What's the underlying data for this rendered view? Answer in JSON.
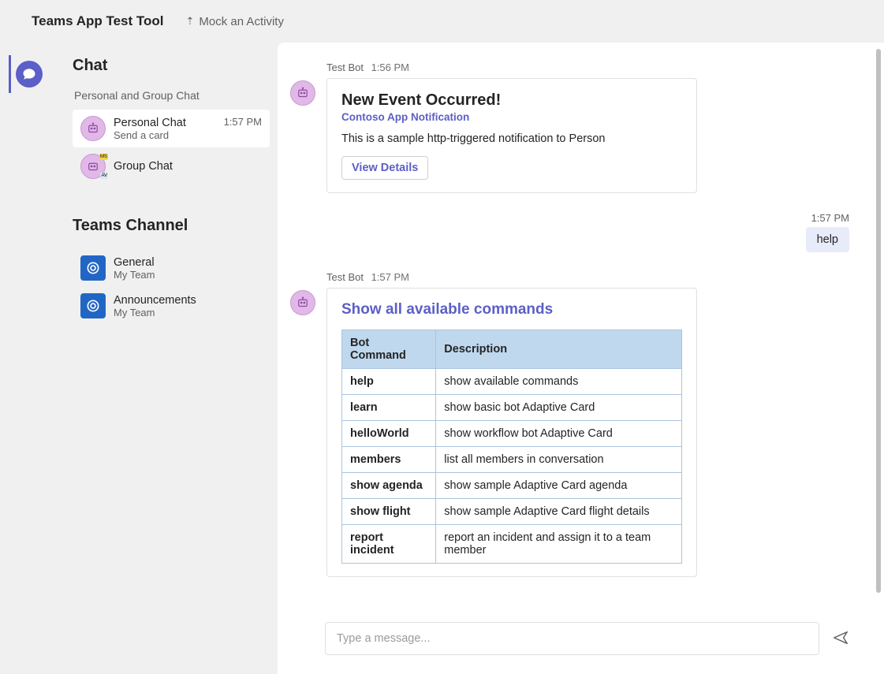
{
  "topbar": {
    "title": "Teams App Test Tool",
    "mock_label": "Mock an Activity"
  },
  "rail": {
    "active": "chat"
  },
  "sidebar": {
    "chat_header": "Chat",
    "chat_subheader": "Personal and Group Chat",
    "items": [
      {
        "title": "Personal Chat",
        "subtitle": "Send a card",
        "time": "1:57 PM",
        "selected": true
      },
      {
        "title": "Group Chat",
        "subtitle": "",
        "time": "",
        "selected": false
      }
    ],
    "channel_header": "Teams Channel",
    "channels": [
      {
        "title": "General",
        "subtitle": "My Team"
      },
      {
        "title": "Announcements",
        "subtitle": "My Team"
      }
    ]
  },
  "messages": {
    "m1": {
      "sender": "Test Bot",
      "time": "1:56 PM",
      "card_title": "New Event Occurred!",
      "card_subtitle": "Contoso App Notification",
      "card_body": "This is a sample http-triggered notification to Person",
      "button_label": "View Details"
    },
    "user1": {
      "time": "1:57 PM",
      "text": "help"
    },
    "m2": {
      "sender": "Test Bot",
      "time": "1:57 PM",
      "heading": "Show all available commands",
      "table": {
        "header_cmd": "Bot Command",
        "header_desc": "Description",
        "rows": [
          {
            "cmd": "help",
            "desc": "show available commands"
          },
          {
            "cmd": "learn",
            "desc": "show basic bot Adaptive Card"
          },
          {
            "cmd": "helloWorld",
            "desc": "show workflow bot Adaptive Card"
          },
          {
            "cmd": "members",
            "desc": "list all members in conversation"
          },
          {
            "cmd": "show agenda",
            "desc": "show sample Adaptive Card agenda"
          },
          {
            "cmd": "show flight",
            "desc": "show sample Adaptive Card flight details"
          },
          {
            "cmd": "report incident",
            "desc": "report an incident and assign it to a team member"
          }
        ]
      }
    }
  },
  "composer": {
    "placeholder": "Type a message..."
  }
}
